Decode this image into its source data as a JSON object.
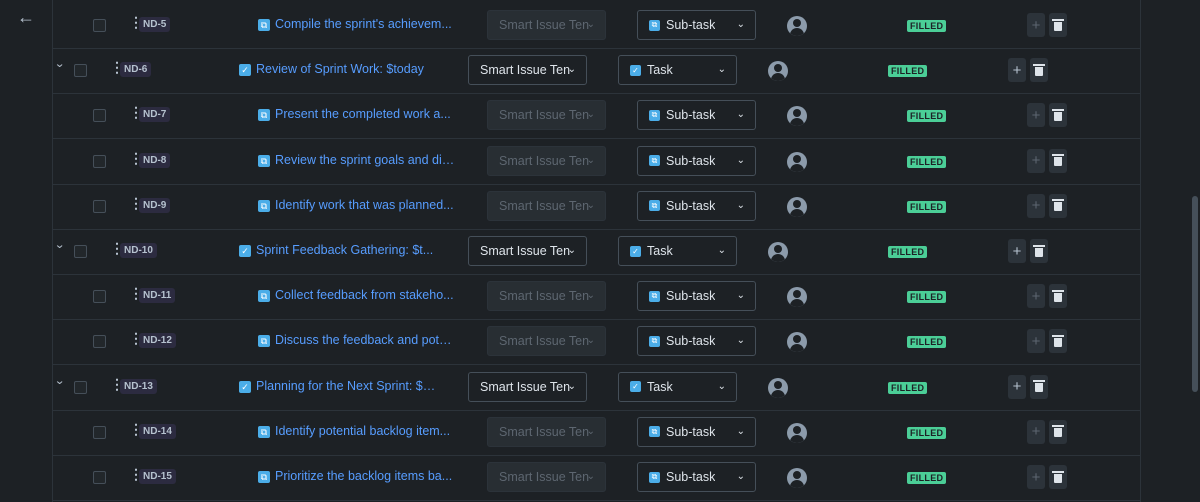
{
  "nav": {
    "back_icon": "arrow-left-icon"
  },
  "rows": [
    {
      "level": "child",
      "key": "ND-5",
      "title": "Compile the sprint's achievem...",
      "template": "Smart Issue Ten",
      "type": "Sub-task",
      "status": "FILLED"
    },
    {
      "level": "parent",
      "key": "ND-6",
      "title": "Review of Sprint Work: $today",
      "template": "Smart Issue Ten",
      "type": "Task",
      "status": "FILLED"
    },
    {
      "level": "child",
      "key": "ND-7",
      "title": "Present the completed work a...",
      "template": "Smart Issue Ten",
      "type": "Sub-task",
      "status": "FILLED"
    },
    {
      "level": "child",
      "key": "ND-8",
      "title": "Review the sprint goals and dis...",
      "template": "Smart Issue Ten",
      "type": "Sub-task",
      "status": "FILLED"
    },
    {
      "level": "child",
      "key": "ND-9",
      "title": "Identify work that was planned...",
      "template": "Smart Issue Ten",
      "type": "Sub-task",
      "status": "FILLED"
    },
    {
      "level": "parent",
      "key": "ND-10",
      "title": "Sprint Feedback Gathering: $t...",
      "template": "Smart Issue Ten",
      "type": "Task",
      "status": "FILLED"
    },
    {
      "level": "child",
      "key": "ND-11",
      "title": "Collect feedback from stakeho...",
      "template": "Smart Issue Ten",
      "type": "Sub-task",
      "status": "FILLED"
    },
    {
      "level": "child",
      "key": "ND-12",
      "title": "Discuss the feedback and pote...",
      "template": "Smart Issue Ten",
      "type": "Sub-task",
      "status": "FILLED"
    },
    {
      "level": "parent",
      "key": "ND-13",
      "title": "Planning for the Next Sprint: $t...",
      "template": "Smart Issue Ten",
      "type": "Task",
      "status": "FILLED"
    },
    {
      "level": "child",
      "key": "ND-14",
      "title": "Identify potential backlog item...",
      "template": "Smart Issue Ten",
      "type": "Sub-task",
      "status": "FILLED"
    },
    {
      "level": "child",
      "key": "ND-15",
      "title": "Prioritize the backlog items ba...",
      "template": "Smart Issue Ten",
      "type": "Sub-task",
      "status": "FILLED"
    }
  ],
  "colors": {
    "background": "#1d2125",
    "link": "#579dff",
    "status_filled": "#4bce97",
    "subtask_icon": "#4bade8",
    "task_icon": "#579dff",
    "key_badge": "#2c2b40"
  }
}
